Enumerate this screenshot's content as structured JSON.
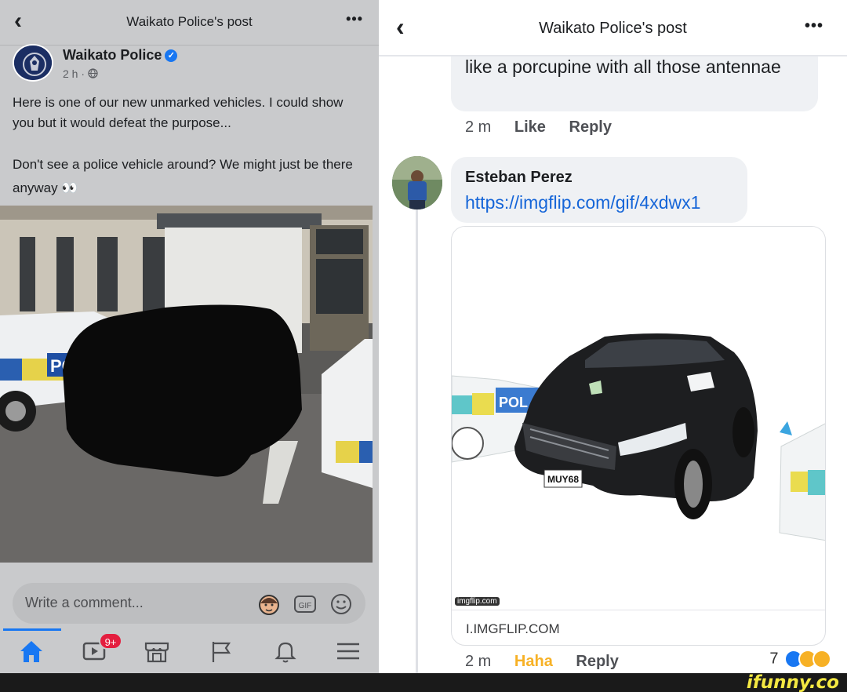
{
  "left": {
    "header": {
      "back_icon": "chevron-left-icon",
      "title": "Waikato Police's post",
      "more_icon": "more-dots-icon",
      "more_label": "•••"
    },
    "post": {
      "author": "Waikato Police",
      "verified_icon": "verified-badge-icon",
      "time": "2 h ·",
      "audience_icon": "globe-icon",
      "text_1": "Here is one of our new unmarked vehicles. I could show you but it would defeat the purpose...",
      "text_2": "Don't see a police vehicle around? We might just be there anyway 👀"
    },
    "comment_box": {
      "placeholder": "Write a comment...",
      "icons": [
        "avatar-sticker-icon",
        "gif-icon",
        "emoji-icon"
      ],
      "gif_label": "GIF"
    },
    "bottom_nav": {
      "items": [
        "home-icon",
        "watch-icon",
        "marketplace-icon",
        "pages-flag-icon",
        "notifications-bell-icon",
        "menu-icon"
      ],
      "watch_badge": "9+",
      "accent": "#1877f2"
    }
  },
  "right": {
    "header": {
      "back_icon": "chevron-left-icon",
      "title": "Waikato Police's post",
      "more_icon": "more-dots-icon",
      "more_label": "•••"
    },
    "prev_comment": {
      "text": "like a porcupine with all those antennae",
      "time": "2 m",
      "like": "Like",
      "reply": "Reply"
    },
    "comment": {
      "author": "Esteban Perez",
      "link": "https://imgflip.com/gif/4xdwx1",
      "watermark": "imgflip.com",
      "domain": "I.IMGFLIP.COM",
      "plate": "MUY68",
      "time": "2 m",
      "reaction_label": "Haha",
      "reply": "Reply",
      "reaction_count": "7",
      "reaction_icons": [
        "like-reaction-icon",
        "wow-reaction-icon",
        "haha-reaction-icon"
      ]
    }
  },
  "footer": {
    "brand": "ifunny.co"
  },
  "colors": {
    "link": "#1565d8",
    "haha": "#f7b125",
    "badge": "#e41e3f",
    "like": "#1877f2"
  }
}
